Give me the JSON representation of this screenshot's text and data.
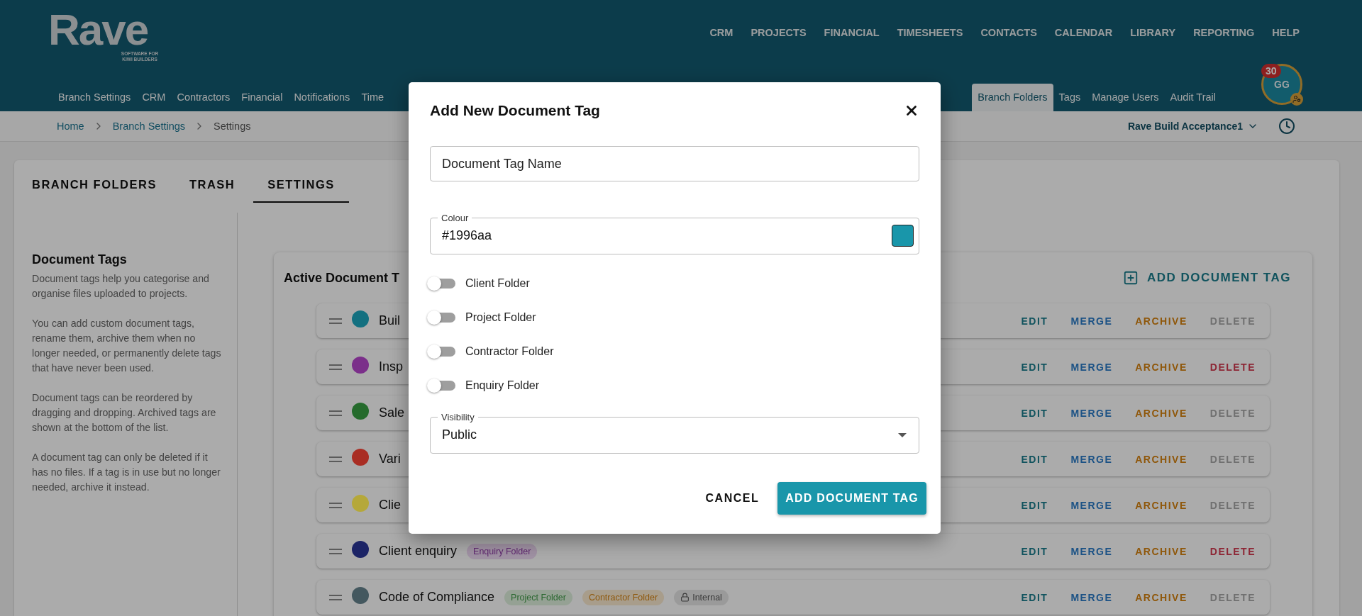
{
  "header": {
    "logo": "Rave",
    "logo_tagline": "SOFTWARE FOR KIWI BUILDERS",
    "main_nav": [
      "CRM",
      "PROJECTS",
      "FINANCIAL",
      "TIMESHEETS",
      "CONTACTS",
      "CALENDAR",
      "LIBRARY",
      "REPORTING",
      "HELP"
    ],
    "sub_nav_left": [
      {
        "label": "Branch Settings",
        "selected": false
      },
      {
        "label": "CRM",
        "selected": false
      },
      {
        "label": "Contractors",
        "selected": false
      },
      {
        "label": "Financial",
        "selected": false
      },
      {
        "label": "Notifications",
        "selected": false
      },
      {
        "label": "Time",
        "selected": false
      }
    ],
    "sub_nav_right": [
      {
        "label": "Branch Folders",
        "selected": true
      },
      {
        "label": "Tags",
        "selected": false
      },
      {
        "label": "Manage Users",
        "selected": false
      },
      {
        "label": "Audit Trail",
        "selected": false
      }
    ],
    "avatar": {
      "initials": "GG",
      "badge": "30"
    }
  },
  "breadcrumb": {
    "items": [
      "Home",
      "Branch Settings",
      "Settings"
    ],
    "branch": "Rave Build Acceptance1"
  },
  "tabs": [
    {
      "label": "BRANCH FOLDERS",
      "selected": false
    },
    {
      "label": "TRASH",
      "selected": false
    },
    {
      "label": "SETTINGS",
      "selected": true
    }
  ],
  "info": {
    "title": "Document Tags",
    "paragraphs": [
      "Document tags help you categorise and organise files uploaded to projects.",
      "You can add custom document tags, rename them, archive them when no longer needed, or permanently delete tags that have never been used.",
      "Document tags can be reordered by dragging and dropping. Archived tags are shown at the bottom of the list.",
      "A document tag can only be deleted if it has no files. If a tag is in use but no longer needed, archive it instead."
    ]
  },
  "tag_list": {
    "title": "Active Document T",
    "add_label": "ADD DOCUMENT TAG",
    "rows": [
      {
        "name": "Buil",
        "color": "#137080",
        "chips": [],
        "actions": [
          {
            "label": "EDIT",
            "kind": "edit",
            "disabled": false
          },
          {
            "label": "MERGE",
            "kind": "merge",
            "disabled": false
          },
          {
            "label": "ARCHIVE",
            "kind": "archive",
            "disabled": false
          },
          {
            "label": "DELETE",
            "kind": "delete",
            "disabled": true
          }
        ]
      },
      {
        "name": "Insp",
        "color": "#7b2f8a",
        "chips": [],
        "actions": [
          {
            "label": "EDIT",
            "kind": "edit",
            "disabled": false
          },
          {
            "label": "MERGE",
            "kind": "merge",
            "disabled": false
          },
          {
            "label": "ARCHIVE",
            "kind": "archive",
            "disabled": false
          },
          {
            "label": "DELETE",
            "kind": "delete",
            "disabled": false
          }
        ]
      },
      {
        "name": "Sale",
        "color": "#256b2c",
        "chips": [],
        "actions": [
          {
            "label": "EDIT",
            "kind": "edit",
            "disabled": false
          },
          {
            "label": "MERGE",
            "kind": "merge",
            "disabled": false
          },
          {
            "label": "ARCHIVE",
            "kind": "archive",
            "disabled": false
          },
          {
            "label": "DELETE",
            "kind": "delete",
            "disabled": true
          }
        ]
      },
      {
        "name": "Vari",
        "color": "#a92d23",
        "chips": [],
        "actions": [
          {
            "label": "EDIT",
            "kind": "edit",
            "disabled": false
          },
          {
            "label": "MERGE",
            "kind": "merge",
            "disabled": false
          },
          {
            "label": "ARCHIVE",
            "kind": "archive",
            "disabled": false
          },
          {
            "label": "DELETE",
            "kind": "delete",
            "disabled": true
          }
        ]
      },
      {
        "name": "Clie",
        "color": "#b5a83a",
        "chips": [],
        "actions": [
          {
            "label": "EDIT",
            "kind": "edit",
            "disabled": false
          },
          {
            "label": "MERGE",
            "kind": "merge",
            "disabled": false
          },
          {
            "label": "ARCHIVE",
            "kind": "archive",
            "disabled": false
          },
          {
            "label": "DELETE",
            "kind": "delete",
            "disabled": true
          }
        ]
      },
      {
        "name": "Client enquiry",
        "color": "#1c2466",
        "chips": [
          {
            "label": "Enquiry Folder",
            "kind": "enquiry"
          }
        ],
        "actions": [
          {
            "label": "EDIT",
            "kind": "edit",
            "disabled": false
          },
          {
            "label": "MERGE",
            "kind": "merge",
            "disabled": false
          },
          {
            "label": "ARCHIVE",
            "kind": "archive",
            "disabled": false
          },
          {
            "label": "DELETE",
            "kind": "delete",
            "disabled": false
          }
        ]
      },
      {
        "name": "Code of Compliance",
        "color": "#44585f",
        "chips": [
          {
            "label": "Project Folder",
            "kind": "project"
          },
          {
            "label": "Contractor Folder",
            "kind": "contractor"
          },
          {
            "label": "Internal",
            "kind": "internal"
          }
        ],
        "actions": [
          {
            "label": "EDIT",
            "kind": "edit",
            "disabled": false
          },
          {
            "label": "MERGE",
            "kind": "merge",
            "disabled": false
          },
          {
            "label": "ARCHIVE",
            "kind": "archive",
            "disabled": false
          },
          {
            "label": "DELETE",
            "kind": "delete",
            "disabled": true
          }
        ]
      }
    ]
  },
  "dialog": {
    "title": "Add New Document Tag",
    "name_field": {
      "placeholder": "Document Tag Name"
    },
    "colour_field": {
      "label": "Colour",
      "value": "#1996aa"
    },
    "switches": [
      {
        "label": "Client Folder",
        "on": false
      },
      {
        "label": "Project Folder",
        "on": false
      },
      {
        "label": "Contractor Folder",
        "on": false
      },
      {
        "label": "Enquiry Folder",
        "on": false
      }
    ],
    "visibility": {
      "label": "Visibility",
      "value": "Public"
    },
    "cancel": "CANCEL",
    "confirm": "ADD DOCUMENT TAG"
  }
}
